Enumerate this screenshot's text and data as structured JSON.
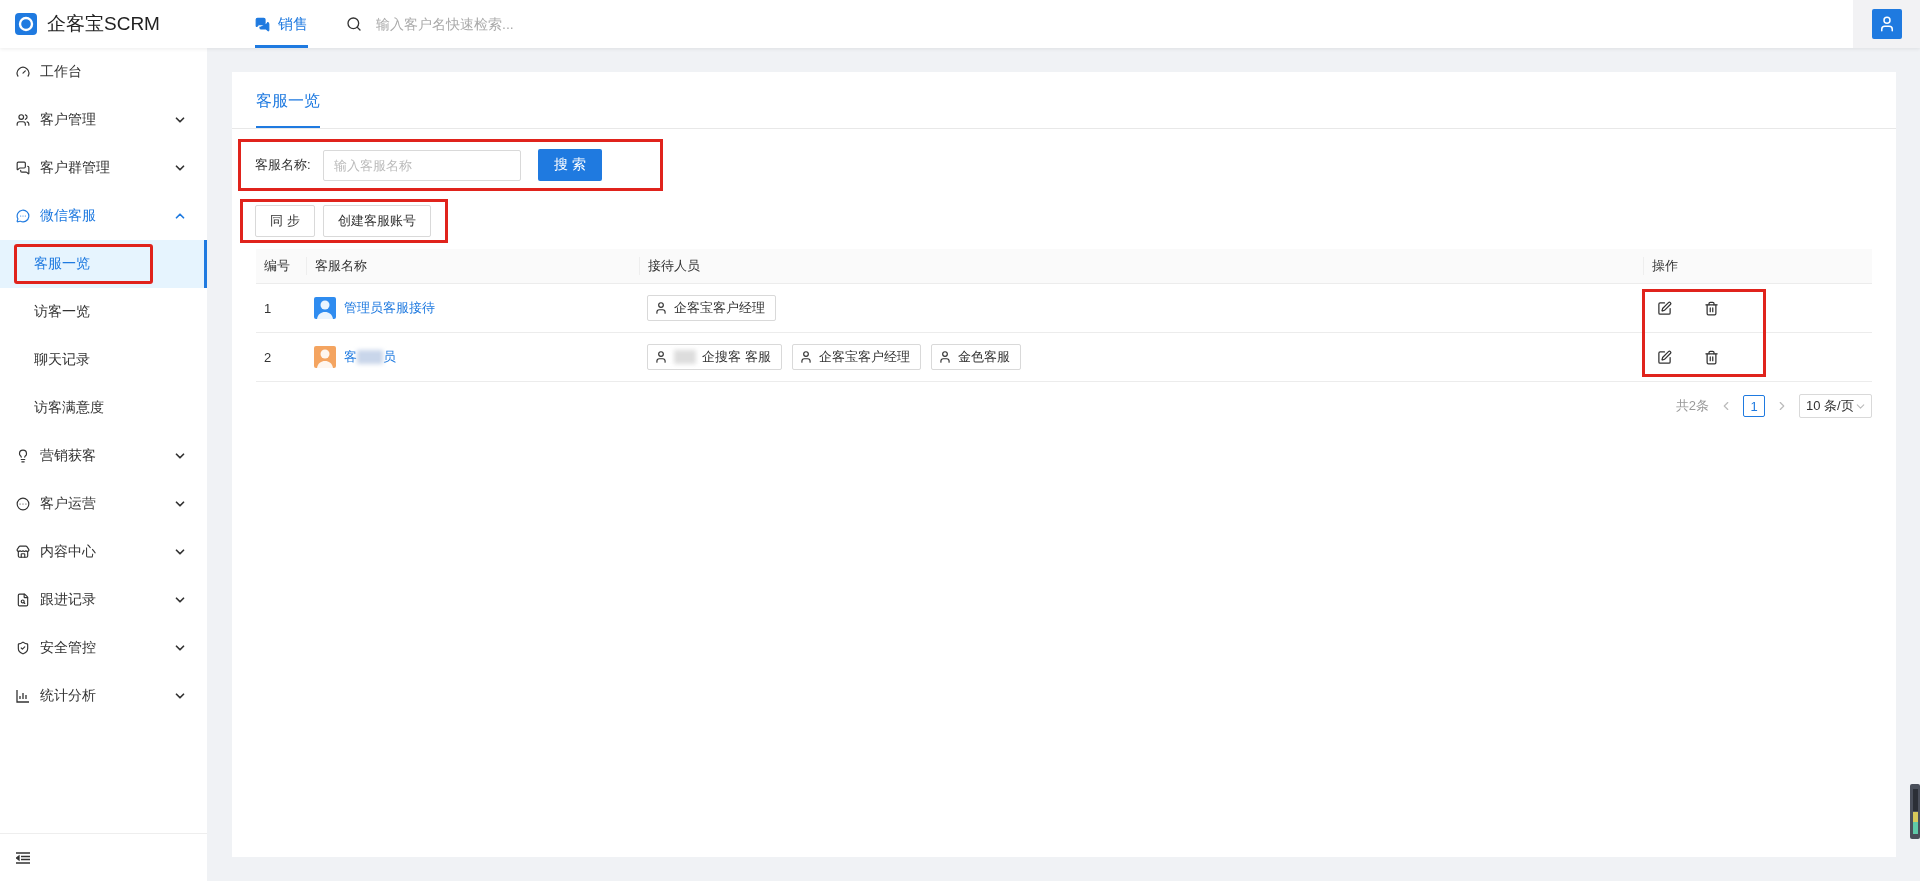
{
  "app": {
    "title": "企客宝SCRM"
  },
  "top_nav": {
    "tabs": [
      {
        "label": "销售",
        "selected": true
      }
    ],
    "search": {
      "placeholder": "输入客户名快速检索..."
    }
  },
  "sidebar": {
    "items": [
      {
        "label": "工作台",
        "kind": "link",
        "selected": false
      },
      {
        "label": "客户管理",
        "kind": "group",
        "expanded": false,
        "selected": false
      },
      {
        "label": "客户群管理",
        "kind": "group",
        "expanded": false,
        "selected": false
      },
      {
        "label": "微信客服",
        "kind": "group",
        "expanded": true,
        "selected": true,
        "children": [
          {
            "label": "客服一览",
            "selected": true,
            "annotated": true
          },
          {
            "label": "访客一览",
            "selected": false,
            "annotated": false
          },
          {
            "label": "聊天记录",
            "selected": false,
            "annotated": false
          },
          {
            "label": "访客满意度",
            "selected": false,
            "annotated": false
          }
        ]
      },
      {
        "label": "营销获客",
        "kind": "group",
        "expanded": false,
        "selected": false
      },
      {
        "label": "客户运营",
        "kind": "group",
        "expanded": false,
        "selected": false
      },
      {
        "label": "内容中心",
        "kind": "group",
        "expanded": false,
        "selected": false
      },
      {
        "label": "跟进记录",
        "kind": "group",
        "expanded": false,
        "selected": false
      },
      {
        "label": "安全管控",
        "kind": "group",
        "expanded": false,
        "selected": false
      },
      {
        "label": "统计分析",
        "kind": "group",
        "expanded": false,
        "selected": false
      }
    ]
  },
  "page": {
    "tabs": [
      {
        "label": "客服一览",
        "selected": true
      }
    ],
    "filter": {
      "label": "客服名称:",
      "placeholder": "输入客服名称",
      "button": "搜 索",
      "annotated": true
    },
    "toolbar": {
      "buttons": [
        "同 步",
        "创建客服账号"
      ],
      "annotated": true
    },
    "table": {
      "columns": [
        "编号",
        "客服名称",
        "接待人员",
        "操作"
      ],
      "actions_annotated": true,
      "rows": [
        {
          "no": "1",
          "name": "管理员客服接待",
          "name_end": "",
          "redacted": false,
          "color": "#2f8cf0",
          "staff": [
            {
              "label": "企客宝客户经理",
              "redacted": false
            }
          ]
        },
        {
          "no": "2",
          "name": "客",
          "name_end": "员",
          "redacted": true,
          "color": "#f4a460",
          "staff": [
            {
              "label": "企搜客 客服",
              "redacted": true
            },
            {
              "label": "企客宝客户经理",
              "redacted": false
            },
            {
              "label": "金色客服",
              "redacted": false
            }
          ]
        }
      ]
    },
    "pagination": {
      "total": "共2条",
      "pages": [
        {
          "label": "1",
          "selected": true
        }
      ],
      "page_size": "10 条/页"
    }
  }
}
